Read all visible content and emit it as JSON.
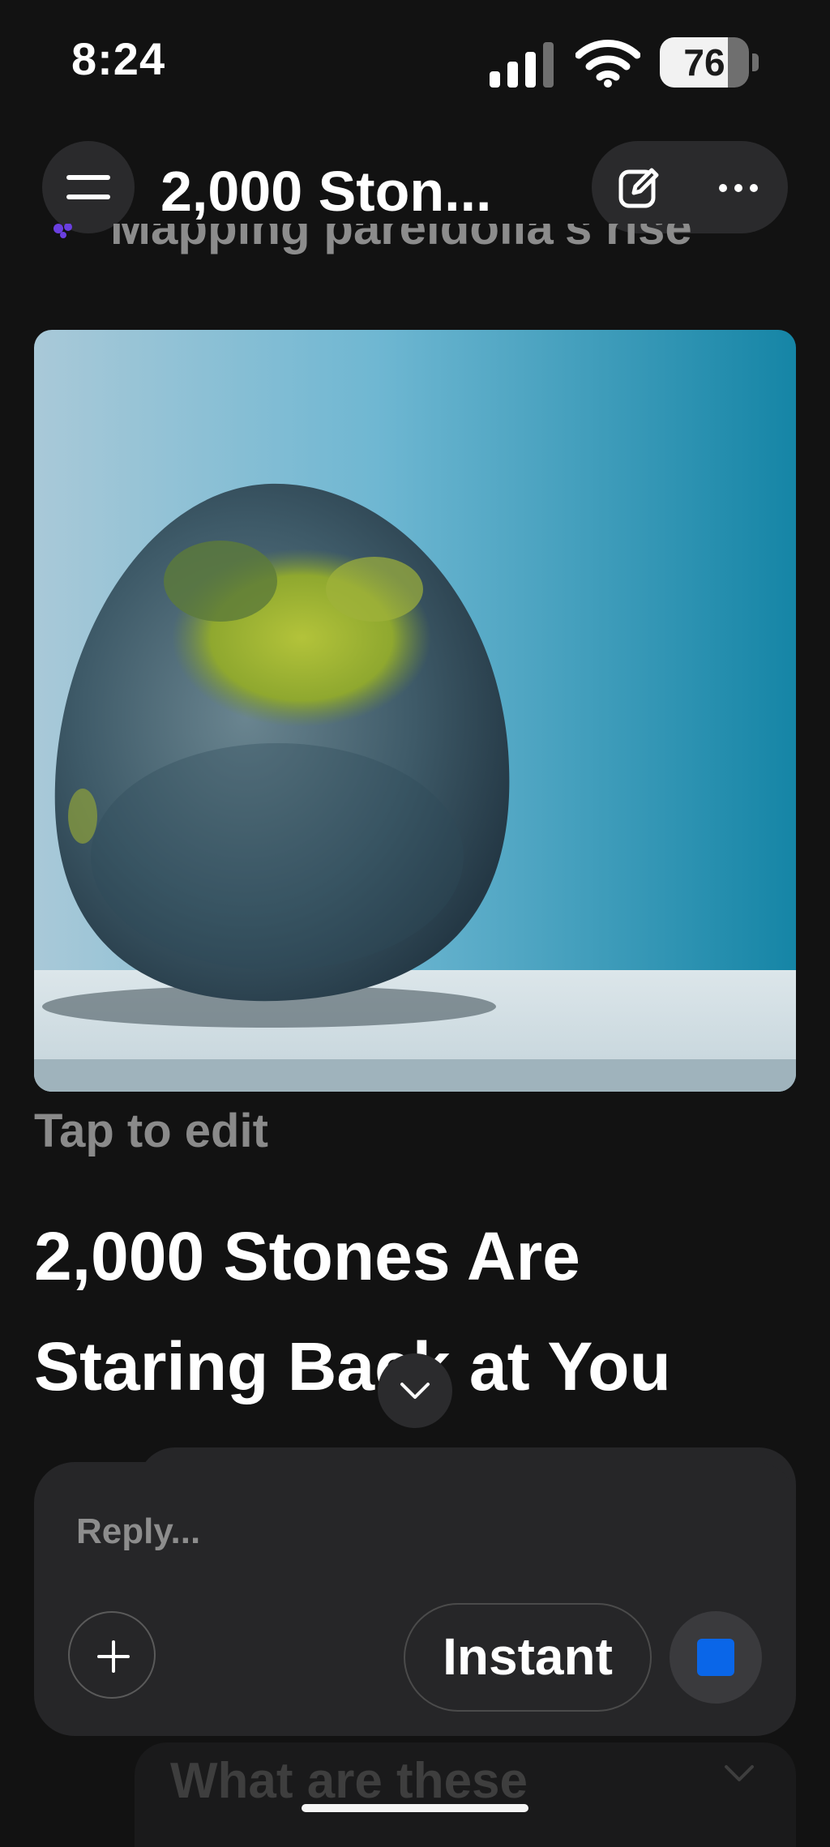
{
  "status_bar": {
    "time": "8:24",
    "battery_percent": "76",
    "battery_level": 0.76
  },
  "header": {
    "title": "2,000 Ston...",
    "menu_icon": "hamburger-menu-icon",
    "edit_icon": "new-chat-edit-icon",
    "more_icon": "more-ellipsis-icon"
  },
  "content": {
    "peek_title": "Mapping pareidolia's rise",
    "image_description_icon": "image",
    "tap_to_edit": "Tap to edit",
    "article_title": "2,000 Stones Are Staring Back at You"
  },
  "composer": {
    "placeholder": "Reply...",
    "mode_label": "Instant",
    "add_icon": "plus-icon",
    "stop_icon": "stop-icon",
    "accent_color": "#0a66e8"
  },
  "suggestion": {
    "text": "What are these"
  }
}
